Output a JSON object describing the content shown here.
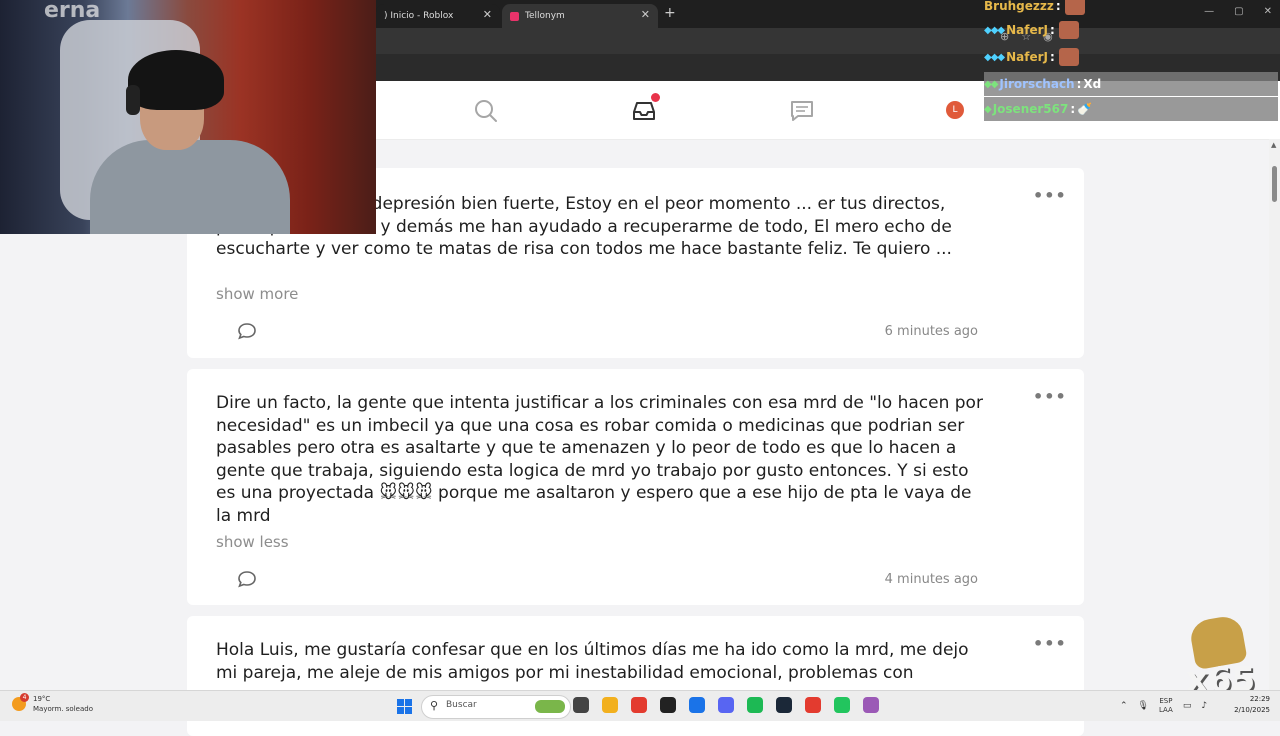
{
  "browser": {
    "tabs": [
      {
        "label": ") Inicio - Roblox"
      },
      {
        "label": "Tellonym"
      }
    ],
    "new_tab": "+",
    "window_controls": [
      "—",
      "▢",
      "✕"
    ]
  },
  "nav": {
    "items": [
      "search-icon",
      "inbox-icon",
      "chat-icon"
    ],
    "avatar_initial": "L",
    "inbox_notification": true
  },
  "posts": [
    {
      "text": "co me agarró una depresión bien fuerte, Estoy en el peor momento ... er tus directos, participar en estos y demás me han ayudado a recuperarme de todo, El mero echo de  escucharte y ver como te matas de risa con todos me hace bastante feliz. Te quiero ...",
      "toggle": "show more",
      "time": "6 minutes ago",
      "menu": "•••"
    },
    {
      "text": "Dire un facto, la gente que intenta justificar a los criminales con esa mrd de \"lo hacen por necesidad\" es un imbecil ya que una cosa es robar comida o medicinas que podrian ser pasables pero otra es asaltarte y que te amenazen y lo peor de todo es que lo hacen a gente que trabaja, siguiendo esta logica de mrd yo trabajo por gusto entonces. Y si esto es una proyectada 🐭🐭🐭 porque me asaltaron y espero que a ese hijo de pta le vaya de la mrd",
      "toggle": "show less",
      "time": "4 minutes ago",
      "menu": "•••"
    },
    {
      "text": "Hola Luis, me gustaría confesar que en los últimos días me ha ido como la mrd, me dejo mi pareja, me aleje de mis amigos por mi inestabilidad emocional, problemas con",
      "menu": "•••"
    }
  ],
  "stream_chat": [
    {
      "user": "Bruhgezzz",
      "msg": ""
    },
    {
      "user": "NaferJ",
      "msg": ""
    },
    {
      "user": "NaferJ",
      "msg": ""
    },
    {
      "user": "Jirorschach",
      "msg": "Xd"
    },
    {
      "user": "Josener567",
      "msg": ""
    }
  ],
  "chat_separator": ":",
  "overlay": {
    "multiplier": "x65",
    "webcam_sign": "erna"
  },
  "taskbar": {
    "weather_temp": "19°C",
    "weather_desc": "Mayorm. soleado",
    "weather_badge": "4",
    "search_placeholder": "Buscar",
    "lang_top": "ESP",
    "lang_bottom": "LAA",
    "time": "22:29",
    "date": "2/10/2025",
    "app_colors": [
      "#444444",
      "#f2b01e",
      "#e33b2f",
      "#222222",
      "#1a73e8",
      "#5865f2",
      "#1db954",
      "#1b2838",
      "#e33b2f",
      "#22c55e",
      "#9b59b6"
    ]
  }
}
